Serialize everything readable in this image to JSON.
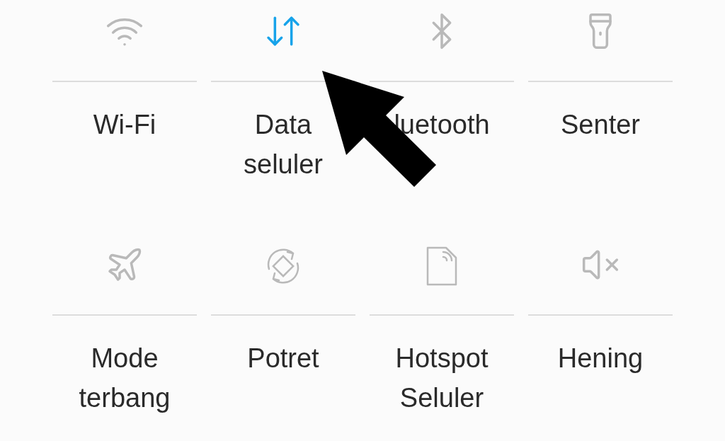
{
  "tiles": [
    {
      "kind": "wifi",
      "label": "Wi-Fi",
      "on": false
    },
    {
      "kind": "data",
      "label": "Data seluler",
      "on": true
    },
    {
      "kind": "bluetooth",
      "label": "luetooth",
      "on": false
    },
    {
      "kind": "flashlight",
      "label": "Senter",
      "on": false
    },
    {
      "kind": "airplane",
      "label": "Mode terbang",
      "on": false
    },
    {
      "kind": "rotate",
      "label": "Potret",
      "on": false
    },
    {
      "kind": "hotspot",
      "label": "Hotspot Seluler",
      "on": false
    },
    {
      "kind": "mute",
      "label": "Hening",
      "on": false
    }
  ]
}
